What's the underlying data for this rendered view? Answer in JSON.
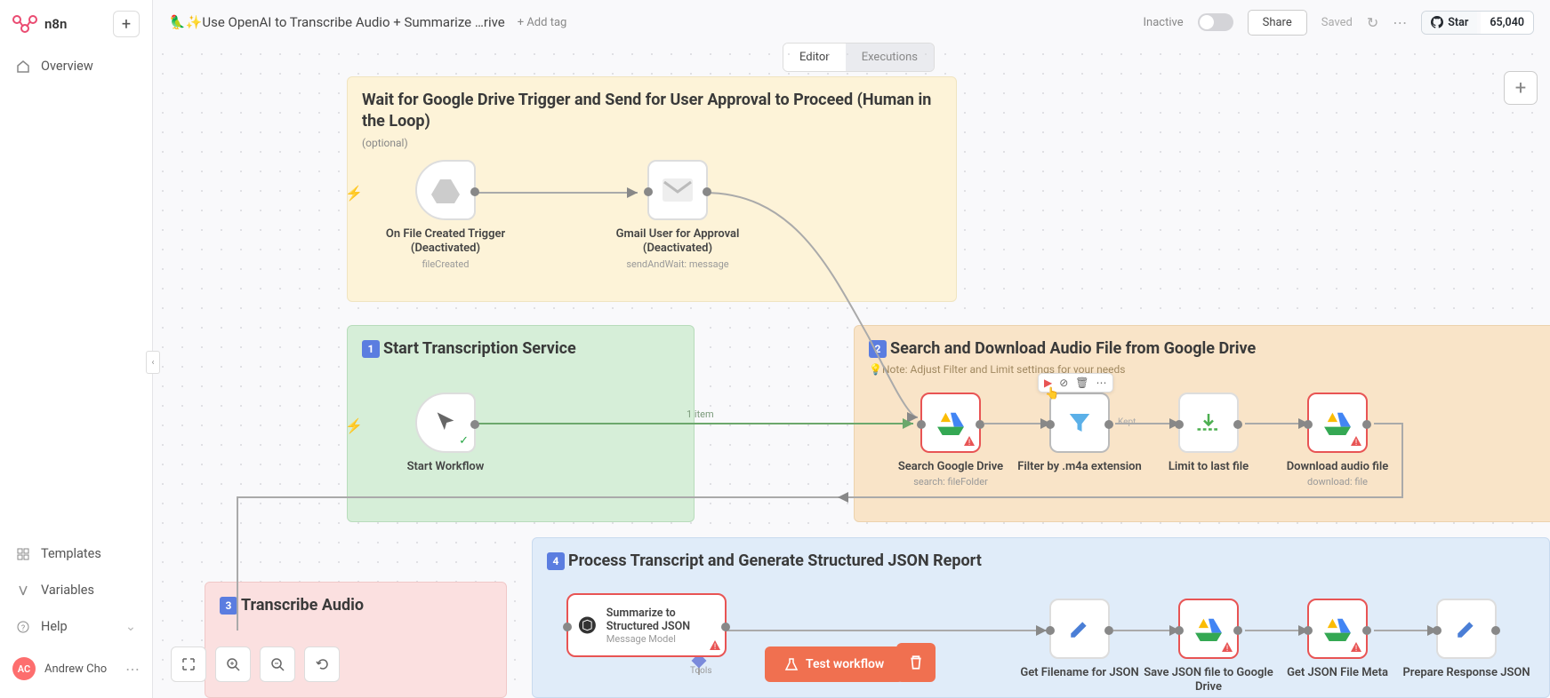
{
  "app": {
    "name": "n8n"
  },
  "sidebar": {
    "overview": "Overview",
    "templates": "Templates",
    "variables": "Variables",
    "help": "Help"
  },
  "user": {
    "initials": "AC",
    "name": "Andrew Cho"
  },
  "workflow": {
    "title": "🦜✨Use OpenAI to Transcribe Audio + Summarize …rive",
    "add_tag": "+ Add tag",
    "status": "Inactive",
    "share": "Share",
    "saved": "Saved"
  },
  "github": {
    "star": "Star",
    "count": "65,040"
  },
  "tabs": {
    "editor": "Editor",
    "executions": "Executions"
  },
  "stickies": {
    "s1": {
      "title": "Wait for Google Drive Trigger and Send for User Approval to Proceed (Human in the Loop)",
      "sub": "(optional)"
    },
    "s2": {
      "badge": "1",
      "title": "Start Transcription Service"
    },
    "s3": {
      "badge": "2",
      "title": "Search and Download Audio File from Google Drive",
      "note": "💡Note: Adjust Filter and Limit settings for your needs"
    },
    "s4": {
      "badge": "3",
      "title": "Transcribe Audio"
    },
    "s5": {
      "badge": "4",
      "title": "Process Transcript and Generate Structured JSON Report"
    }
  },
  "nodes": {
    "n1": {
      "label": "On File Created Trigger (Deactivated)",
      "sub": "fileCreated"
    },
    "n2": {
      "label": "Gmail User for Approval (Deactivated)",
      "sub": "sendAndWait: message"
    },
    "n3": {
      "label": "Start Workflow"
    },
    "n4": {
      "label": "Search Google Drive",
      "sub": "search: fileFolder"
    },
    "n5": {
      "label": "Filter by .m4a extension"
    },
    "n6": {
      "label": "Limit to last file"
    },
    "n7": {
      "label": "Download audio file",
      "sub": "download: file"
    },
    "n8": {
      "label": "Summarize to Structured JSON",
      "sub": "Message Model"
    },
    "n9": {
      "label": "Get Filename for JSON"
    },
    "n10": {
      "label": "Save JSON file to Google Drive"
    },
    "n11": {
      "label": "Get JSON File Meta"
    },
    "n12": {
      "label": "Prepare Response JSON"
    }
  },
  "edge_labels": {
    "items": "1 item",
    "kept": "Kept",
    "tools": "Tools"
  },
  "actions": {
    "test": "Test workflow"
  }
}
